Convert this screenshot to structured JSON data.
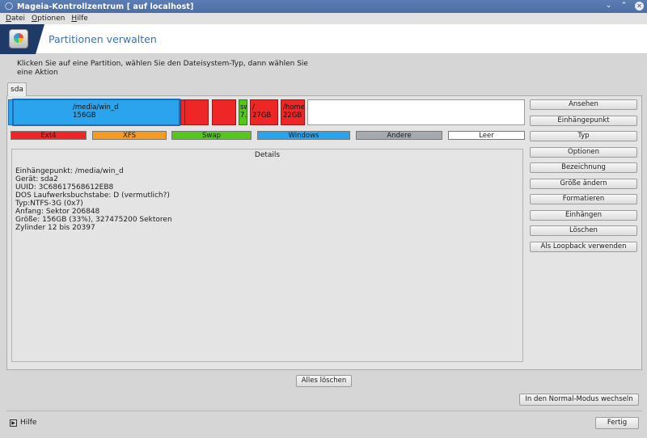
{
  "window": {
    "title": "Mageia-Kontrollzentrum  [ auf localhost]",
    "controls": [
      "⌄",
      "⌃",
      "✕"
    ]
  },
  "menubar": [
    {
      "label": "Datei",
      "ul": "D",
      "rest": "atei"
    },
    {
      "label": "Optionen",
      "ul": "O",
      "rest": "ptionen"
    },
    {
      "label": "Hilfe",
      "ul": "H",
      "rest": "ilfe"
    }
  ],
  "banner": {
    "title": "Partitionen verwalten"
  },
  "instruction": "Klicken Sie auf eine Partition, wählen Sie den Dateisystem-Typ, dann wählen Sie eine Aktion",
  "disk_tab": "sda",
  "partitions": [
    {
      "line1": "",
      "line2": "",
      "type": "Windows"
    },
    {
      "line1": "/media/win_d",
      "line2": "156GB",
      "type": "Windows",
      "selected": true
    },
    {
      "line1": "",
      "line2": "",
      "type": "Ext4"
    },
    {
      "line1": "",
      "line2": "",
      "type": "Ext4"
    },
    {
      "line1": "",
      "line2": "",
      "type": "Ext4"
    },
    {
      "line1": "sw",
      "line2": "7.",
      "type": "Swap"
    },
    {
      "line1": "/",
      "line2": "27GB",
      "type": "Ext4"
    },
    {
      "line1": "/home",
      "line2": "22GB",
      "type": "Ext4"
    },
    {
      "line1": "",
      "line2": "",
      "type": "Leer"
    }
  ],
  "legend": [
    {
      "label": "Ext4",
      "color": "#ef2626"
    },
    {
      "label": "XFS",
      "color": "#f59a23"
    },
    {
      "label": "Swap",
      "color": "#55c61d"
    },
    {
      "label": "Windows",
      "color": "#2aa4ec"
    },
    {
      "label": "Andere",
      "color": "#a5a9b0"
    },
    {
      "label": "Leer",
      "color": "#ffffff"
    }
  ],
  "details": {
    "title": "Details",
    "lines": [
      "Einhängepunkt: /media/win_d",
      "Gerät: sda2",
      "UUID: 3C68617568612EB8",
      "DOS Laufwerksbuchstabe: D (vermutlich?)",
      "Typ:NTFS-3G (0x7)",
      "Anfang: Sektor 206848",
      "Größe: 156GB (33%), 327475200 Sektoren",
      "Zylinder 12 bis 20397"
    ]
  },
  "actions": [
    "Ansehen",
    "Einhängepunkt",
    "Typ",
    "Optionen",
    "Bezeichnung",
    "Größe ändern",
    "Formatieren",
    "Einhängen",
    "Löschen",
    "Als Loopback verwenden"
  ],
  "clear_all": "Alles löschen",
  "normal_mode": "In den Normal-Modus wechseln",
  "help": "Hilfe",
  "done": "Fertig"
}
